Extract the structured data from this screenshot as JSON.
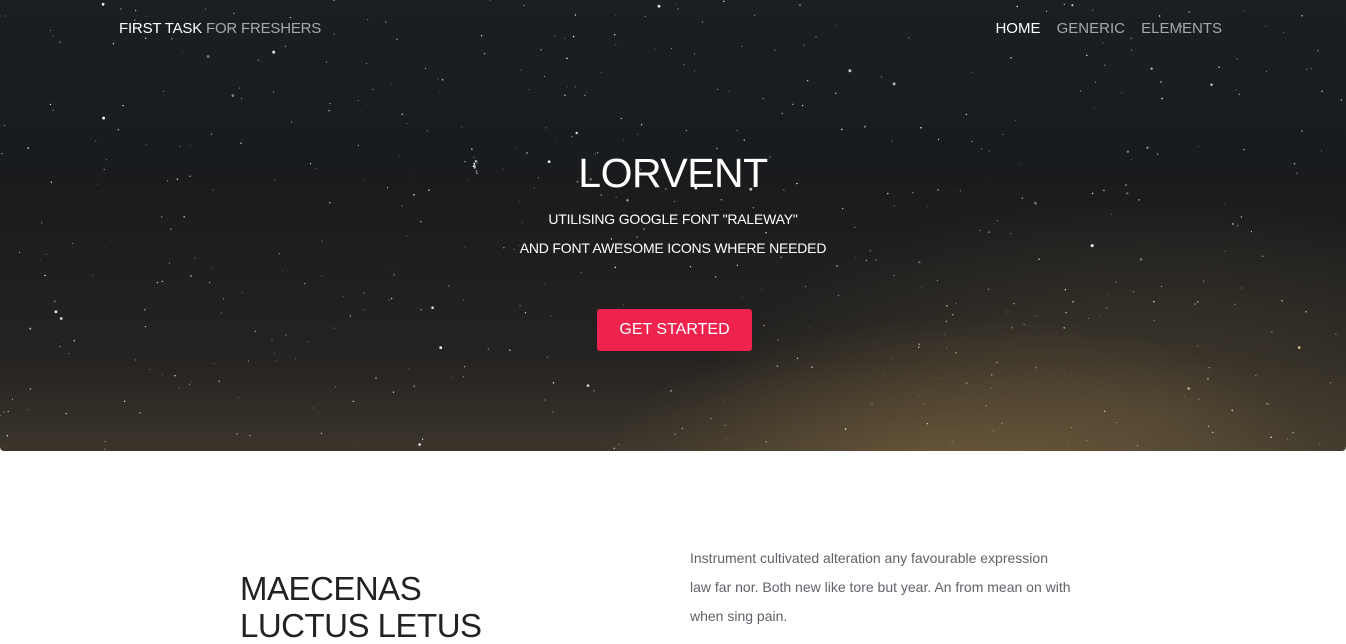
{
  "nav": {
    "brand_strong": "FIRST TASK",
    "brand_light": "FOR FRESHERS",
    "links": [
      {
        "label": "HOME"
      },
      {
        "label": "GENERIC"
      },
      {
        "label": "ELEMENTS"
      }
    ]
  },
  "hero": {
    "title": "LORVENT",
    "subtitle_line1": "UTILISING GOOGLE FONT \"RALEWAY\"",
    "subtitle_line2": "AND FONT AWESOME ICONS WHERE NEEDED",
    "cta_label": "GET STARTED"
  },
  "section": {
    "title_line1": "MAECENAS",
    "title_line2": "LUCTUS LETUS",
    "text_lines": [
      "Instrument cultivated alteration any favourable expression",
      "law far nor. Both new like tore but year. An from mean on with",
      "when sing pain."
    ]
  },
  "colors": {
    "accent": "#f0234f",
    "hero_bg": "#1a1f24",
    "nav_inactive": "#a5a8ab"
  }
}
